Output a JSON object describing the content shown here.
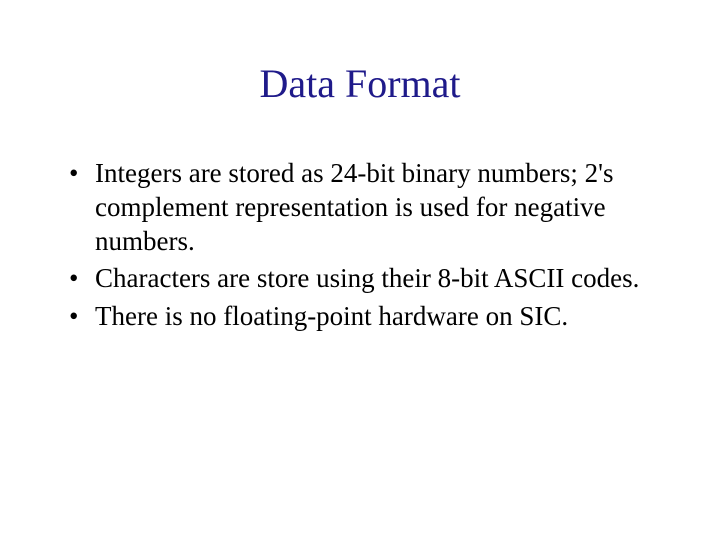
{
  "slide": {
    "title": "Data Format",
    "bullets": [
      "Integers are stored as 24-bit binary numbers; 2's complement representation is used for negative numbers.",
      "Characters are store using their 8-bit ASCII codes.",
      "There is no floating-point hardware on SIC."
    ]
  }
}
